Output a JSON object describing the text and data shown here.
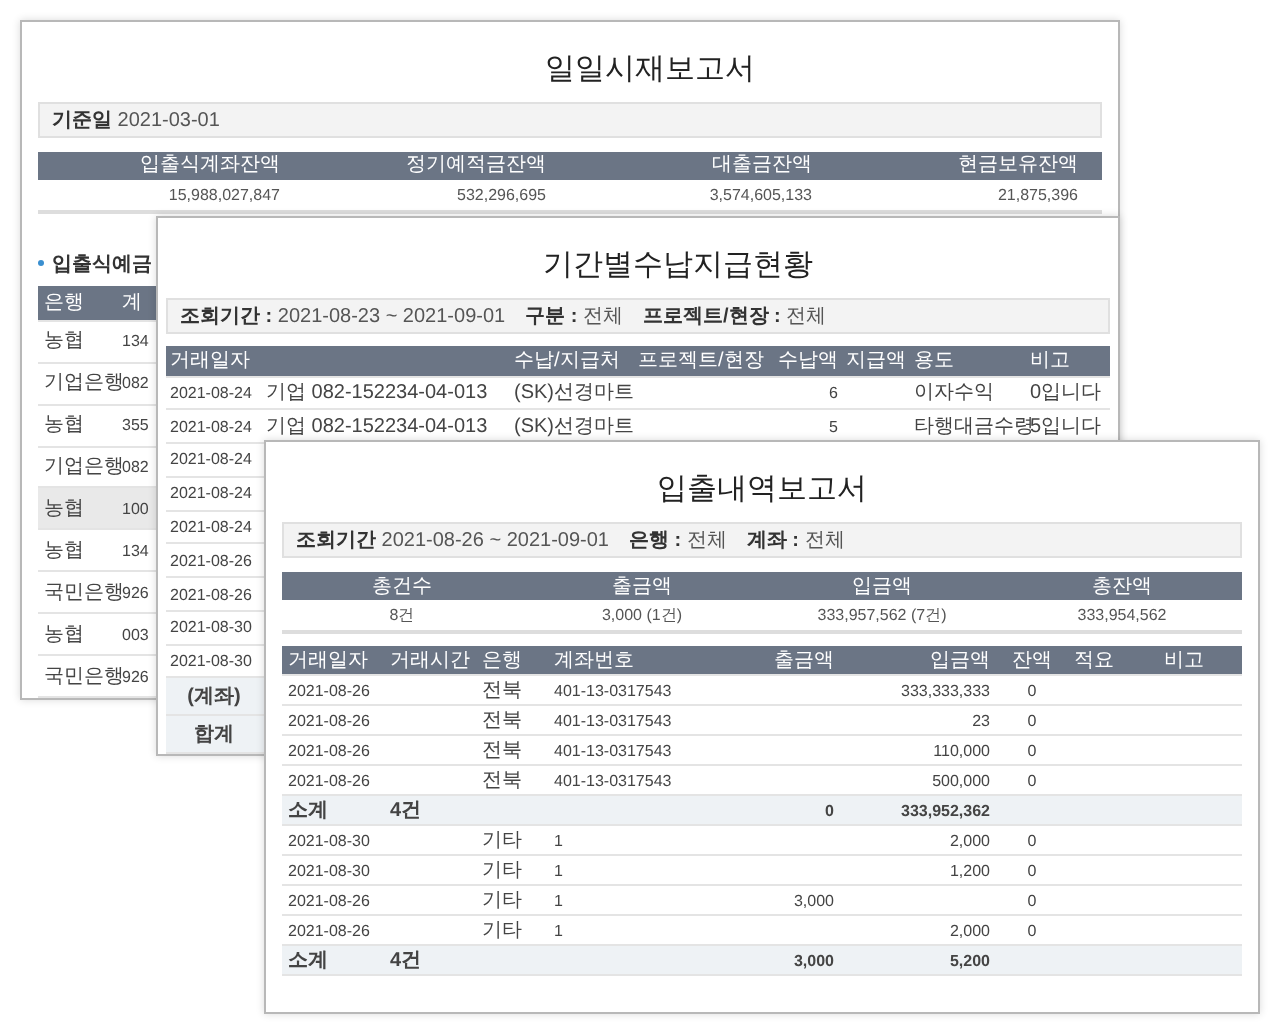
{
  "daily_cash_report": {
    "title": "일일시재보고서",
    "filter": {
      "label": "기준일",
      "value": "2021-03-01"
    },
    "summary": {
      "columns": [
        "입출식계좌잔액",
        "정기예적금잔액",
        "대출금잔액",
        "현금보유잔액"
      ],
      "values": [
        "15,988,027,847",
        "532,296,695",
        "3,574,605,133",
        "21,875,396"
      ]
    },
    "section_title": "입출식예금",
    "table": {
      "columns": [
        "은행",
        "계"
      ],
      "rows": [
        {
          "bank": "농협",
          "account": "134",
          "selected": false
        },
        {
          "bank": "기업은행",
          "account": "082",
          "selected": false
        },
        {
          "bank": "농협",
          "account": "355",
          "selected": false
        },
        {
          "bank": "기업은행",
          "account": "082",
          "selected": false
        },
        {
          "bank": "농협",
          "account": "100",
          "selected": true
        },
        {
          "bank": "농협",
          "account": "134",
          "selected": false
        },
        {
          "bank": "국민은행",
          "account": "926",
          "selected": false
        },
        {
          "bank": "농협",
          "account": "003",
          "selected": false
        },
        {
          "bank": "국민은행",
          "account": "926",
          "selected": false
        }
      ]
    }
  },
  "period_receipts_report": {
    "title": "기간별수납지급현황",
    "filters": [
      {
        "label": "조회기간 :",
        "value": "2021-08-23 ~ 2021-09-01"
      },
      {
        "label": "구분 :",
        "value": "전체"
      },
      {
        "label": "프로젝트/현장 :",
        "value": "전체"
      }
    ],
    "columns": [
      "거래일자",
      "수납/지급처",
      "프로젝트/현장",
      "수납액",
      "지급액",
      "용도",
      "비고"
    ],
    "rows": [
      {
        "date": "2021-08-24",
        "account": "기업 082-152234-04-013",
        "payee": "(SK)선경마트",
        "received": "6",
        "use": "이자수익",
        "note": "0입니다"
      },
      {
        "date": "2021-08-24",
        "account": "기업 082-152234-04-013",
        "payee": "(SK)선경마트",
        "received": "5",
        "use": "타행대금수령",
        "note": "5입니다"
      },
      {
        "date": "2021-08-24"
      },
      {
        "date": "2021-08-24"
      },
      {
        "date": "2021-08-24"
      },
      {
        "date": "2021-08-26"
      },
      {
        "date": "2021-08-26"
      },
      {
        "date": "2021-08-30"
      },
      {
        "date": "2021-08-30"
      }
    ],
    "footer_rows": [
      "(계좌)",
      "합계"
    ]
  },
  "transactions_report": {
    "title": "입출내역보고서",
    "filters": [
      {
        "label": "조회기간",
        "value": "2021-08-26 ~ 2021-09-01"
      },
      {
        "label": "은행 :",
        "value": "전체"
      },
      {
        "label": "계좌 :",
        "value": "전체"
      }
    ],
    "summary": {
      "columns": [
        "총건수",
        "출금액",
        "입금액",
        "총잔액"
      ],
      "values": [
        "8건",
        "3,000 (1건)",
        "333,957,562 (7건)",
        "333,954,562"
      ]
    },
    "columns": [
      "거래일자",
      "거래시간",
      "은행",
      "계좌번호",
      "출금액",
      "입금액",
      "잔액",
      "적요",
      "비고"
    ],
    "rows": [
      {
        "kind": "entry",
        "date": "2021-08-26",
        "bank": "전북",
        "account": "401-13-0317543",
        "deposit": "333,333,333",
        "balance": "0"
      },
      {
        "kind": "entry",
        "date": "2021-08-26",
        "bank": "전북",
        "account": "401-13-0317543",
        "deposit": "23",
        "balance": "0"
      },
      {
        "kind": "entry",
        "date": "2021-08-26",
        "bank": "전북",
        "account": "401-13-0317543",
        "deposit": "110,000",
        "balance": "0"
      },
      {
        "kind": "entry",
        "date": "2021-08-26",
        "bank": "전북",
        "account": "401-13-0317543",
        "deposit": "500,000",
        "balance": "0"
      },
      {
        "kind": "subtotal",
        "label": "소계",
        "count": "4건",
        "withdrawal": "0",
        "deposit": "333,952,362"
      },
      {
        "kind": "entry",
        "date": "2021-08-30",
        "bank": "기타",
        "account": "1",
        "deposit": "2,000",
        "balance": "0"
      },
      {
        "kind": "entry",
        "date": "2021-08-30",
        "bank": "기타",
        "account": "1",
        "deposit": "1,200",
        "balance": "0"
      },
      {
        "kind": "entry",
        "date": "2021-08-26",
        "bank": "기타",
        "account": "1",
        "withdrawal": "3,000",
        "balance": "0"
      },
      {
        "kind": "entry",
        "date": "2021-08-26",
        "bank": "기타",
        "account": "1",
        "deposit": "2,000",
        "balance": "0"
      },
      {
        "kind": "subtotal",
        "label": "소계",
        "count": "4건",
        "withdrawal": "3,000",
        "deposit": "5,200"
      }
    ]
  }
}
